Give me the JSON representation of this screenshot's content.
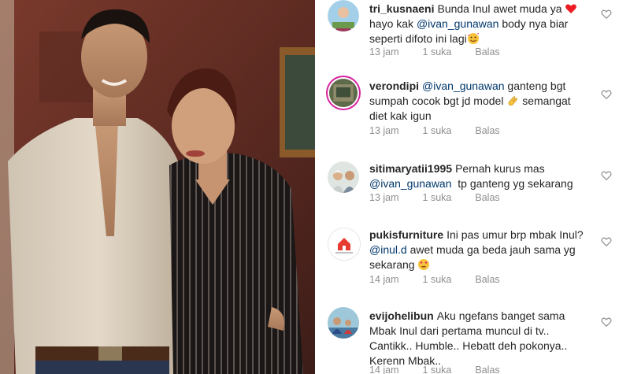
{
  "photo": {
    "alt_icon": "photo-image"
  },
  "comments": [
    {
      "username": "tri_kusnaeni",
      "text_before": "Bunda Inul awet muda ya",
      "emoji1": "red-heart-icon",
      "text_line2a": "hayo kak ",
      "mention": "@ivan_gunawan",
      "text_line2b": " body nya biar",
      "text_line3": "seperti difoto ini lagi",
      "emoji2": "smiling-hearts-face-icon",
      "time": "13 jam",
      "likes": "1 suka",
      "reply": "Balas"
    },
    {
      "username": "verondipi",
      "mention": "@ivan_gunawan",
      "text_line1b": " ganteng bgt",
      "text_line2": "sumpah cocok bgt jd model",
      "emoji1": "clapping-hands-icon",
      "text_line2b": " semangat",
      "text_line3": "diet kak igun",
      "time": "13 jam",
      "likes": "1 suka",
      "reply": "Balas"
    },
    {
      "username": "sitimaryatii1995",
      "text_line1": "Pernah kurus mas",
      "mention": "@ivan_gunawan",
      "text_line2b": "  tp ganteng yg sekarang",
      "time": "13 jam",
      "likes": "1 suka",
      "reply": "Balas"
    },
    {
      "username": "pukisfurniture",
      "text_line1": "Ini pas umur brp mbak Inul?",
      "mention": "@inul.d",
      "text_line2b": " awet muda ga beda jauh sama yg",
      "text_line3": "sekarang",
      "emoji1": "heart-eyes-face-icon",
      "time": "14 jam",
      "likes": "1 suka",
      "reply": "Balas"
    },
    {
      "username": "evijohelibun",
      "text_line1": "Aku ngefans banget sama",
      "text_line2": "Mbak Inul dari pertama muncul di tv..",
      "text_line3": "Cantikk.. Humble.. Hebatt deh pokonya..",
      "text_line4": "Kerenn Mbak..",
      "time": "14 jam",
      "likes": "1 suka",
      "reply": "Balas"
    }
  ],
  "colors": {
    "text": "#262626",
    "mention": "#00376b",
    "meta": "#8e8e8e",
    "heart_emoji": "#ed4956"
  }
}
